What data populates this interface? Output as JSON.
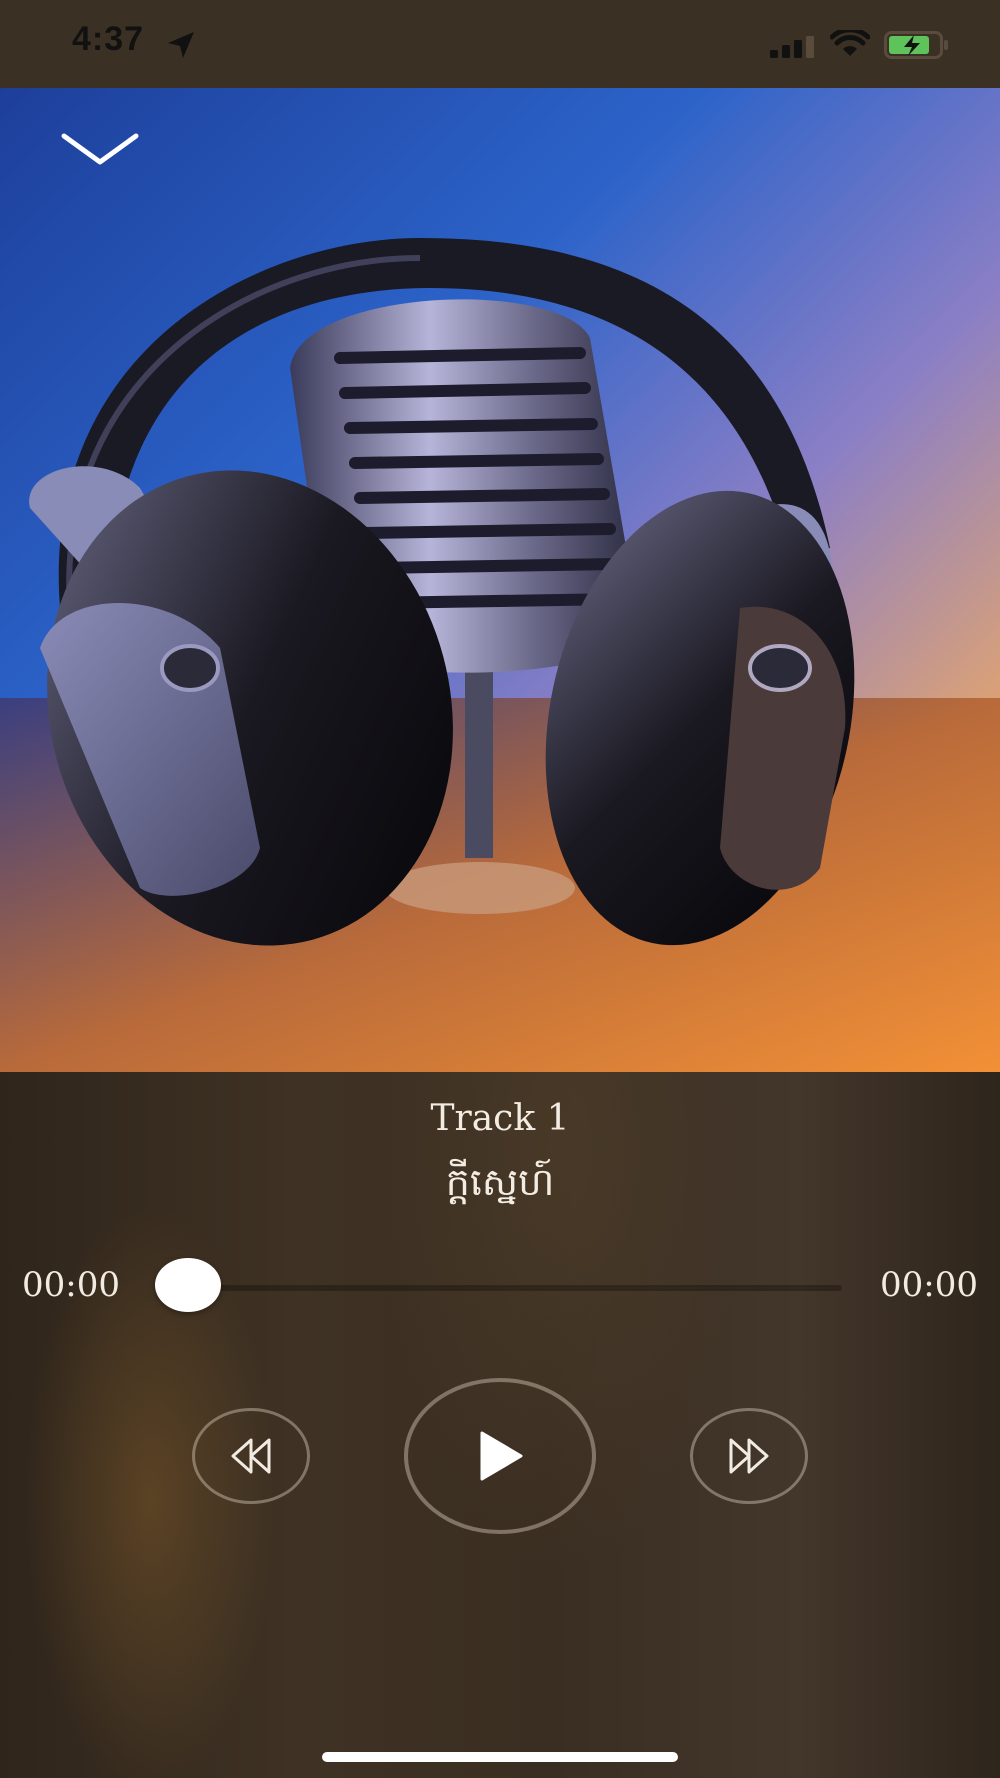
{
  "status_bar": {
    "time": "4:37",
    "icons": [
      "location-arrow-icon",
      "cellular-signal-icon",
      "wifi-icon",
      "battery-charging-icon"
    ]
  },
  "artwork": {
    "description_icon": "headphones-microphone-artwork",
    "collapse_icon": "chevron-down-icon"
  },
  "track": {
    "title": "Track 1",
    "subtitle": "ក្តីស្នេហ៍"
  },
  "progress": {
    "elapsed": "00:00",
    "duration": "00:00",
    "fraction": 0
  },
  "controls": {
    "rewind_icon": "rewind-icon",
    "play_icon": "play-icon",
    "forward_icon": "fast-forward-icon"
  },
  "colors": {
    "background": "#3a2e22",
    "text": "#f3ece2",
    "thumb": "#ffffff",
    "battery_fill": "#5ec35a"
  }
}
